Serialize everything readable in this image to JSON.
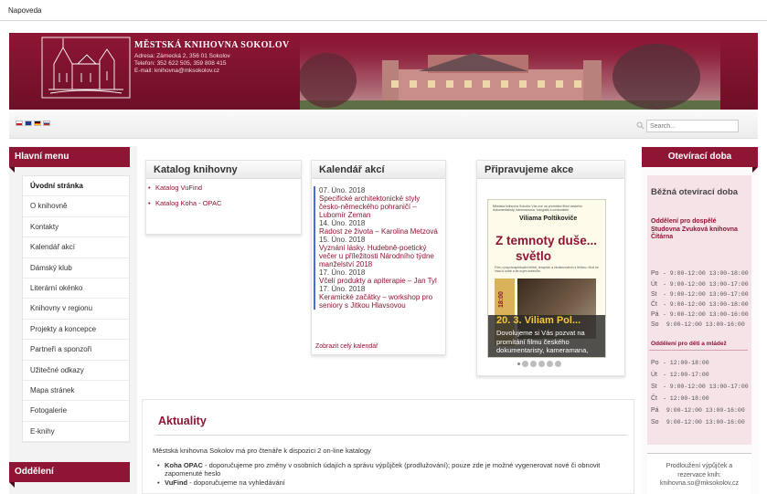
{
  "topbar": {
    "help": "Napoveda"
  },
  "header": {
    "library_name": "MĚSTSKÁ KNIHOVNA SOKOLOV",
    "address": "Adresa: Zámecká 2, 356 01 Sokolov",
    "phone": "Telefon: 352 622 505, 359 808 415",
    "email": "E-mail: knihovna@mksokolov.cz",
    "brand_color": "#8e1634"
  },
  "languages": [
    "cs",
    "en",
    "de",
    "ru"
  ],
  "search": {
    "placeholder": "Search..."
  },
  "main_menu": {
    "title": "Hlavní menu",
    "items": [
      "Úvodní stránka",
      "O knihovně",
      "Kontakty",
      "Kalendář akcí",
      "Dámský klub",
      "Literární okénko",
      "Knihovny v regionu",
      "Projekty a koncepce",
      "Partneři a sponzoři",
      "Užitečné odkazy",
      "Mapa stránek",
      "Fotogalerie",
      "E-knihy"
    ]
  },
  "departments": {
    "title": "Oddělení"
  },
  "catalog": {
    "title": "Katalog knihovny",
    "links": [
      "Katalog VuFind",
      "Katalog Koha - OPAC"
    ]
  },
  "calendar": {
    "title": "Kalendář akcí",
    "events": [
      {
        "date": "07. Úno. 2018",
        "title": "Specifické architektonické styly česko-německého pohraničí – Lubomír Zeman"
      },
      {
        "date": "14. Úno. 2018",
        "title": "Radost ze života – Karolina Metzová"
      },
      {
        "date": "15. Úno. 2018",
        "title": "Vyznání lásky. Hudebně-poetický večer u příležitosti Národního týdne manželství 2018"
      },
      {
        "date": "17. Úno. 2018",
        "title": "Včelí produkty a apiterapie – Jan Tyl"
      },
      {
        "date": "17. Úno. 2018",
        "title": "Keramické začátky – workshop pro seniory s Jitkou Hlavsovou"
      }
    ],
    "show_all": "Zobrazit celý kalendář"
  },
  "upcoming": {
    "title": "Připravujeme akce",
    "poster_small": "Městská knihovna Sokolov Vás zve na promítání filmu českého dokumentaristy, kameramana, fotografa a cestovatele",
    "poster_author": "Viliama Poltikoviče",
    "poster_title_1": "Z temnoty duše...",
    "poster_title_2": "světlo",
    "poster_desc": "Film o psychospirituální léčbě, terapiích a zkušenostech s léčbou. Muž se vrací k sobě a ke svým kořenům.",
    "poster_time": "18:00",
    "poster_side": "Promítání filmu",
    "slide_title": "20. 3. Viliam Pol...",
    "slide_desc": "Dovolujeme si Vás pozvat na promítání filmu českého dokumentaristy, kameramana,",
    "slides_count": 6,
    "active_slide": 1
  },
  "news": {
    "title": "Aktuality",
    "intro": "Městská knihovna Sokolov má pro čtenáře k dispozici 2 on-line katalogy",
    "items": [
      {
        "name": "Koha OPAC",
        "text": " - doporučujeme pro změny v osobních údajích a správu výpůjček (prodlužování); pouze zde je možné vygenerovat nové či obnovit zapomenuté heslo"
      },
      {
        "name": "VuFind",
        "text": " - doporučujeme na vyhledávání"
      }
    ]
  },
  "opening_hours": {
    "title": "Otevírací doba",
    "heading": "Běžná otevírací doba",
    "adult_dept": "Oddělení pro dospělé Studovna Zvuková knihovna Čítárna",
    "adult_rows": [
      {
        "day": "Po",
        "hours": "-  9:00-12:00  13:00-18:00"
      },
      {
        "day": "Út",
        "hours": "-  9:00-12:00  13:00-17:00"
      },
      {
        "day": "St",
        "hours": "-  9:00-12:00  13:00-17:00"
      },
      {
        "day": "Čt",
        "hours": "-  9:00-12:00  13:00-18:00"
      },
      {
        "day": "Pá",
        "hours": "-  9:00-12:00  13:00-16:00"
      },
      {
        "day": "So",
        "hours": "   9:00-12:00  13:00-16:00"
      }
    ],
    "kids_dept": "Oddělení pro děti a mládež",
    "kids_rows": [
      {
        "day": "Po",
        "hours": "-            12:00-18:00"
      },
      {
        "day": "Út",
        "hours": "-            12:00-17:00"
      },
      {
        "day": "St",
        "hours": "-  9:00-12:00  13:00-17:00"
      },
      {
        "day": "Čt",
        "hours": "-            12:00-18:00"
      },
      {
        "day": "Pá",
        "hours": "   9:00-12:00  13:00-16:00"
      },
      {
        "day": "So",
        "hours": "   9:00-12:00  13:00-16:00"
      }
    ],
    "renewal_line1": "Prodloužení výpůjček a",
    "renewal_line2": "rezervace knih:",
    "renewal_email": "knihovna.so@mksokolov.cz"
  }
}
